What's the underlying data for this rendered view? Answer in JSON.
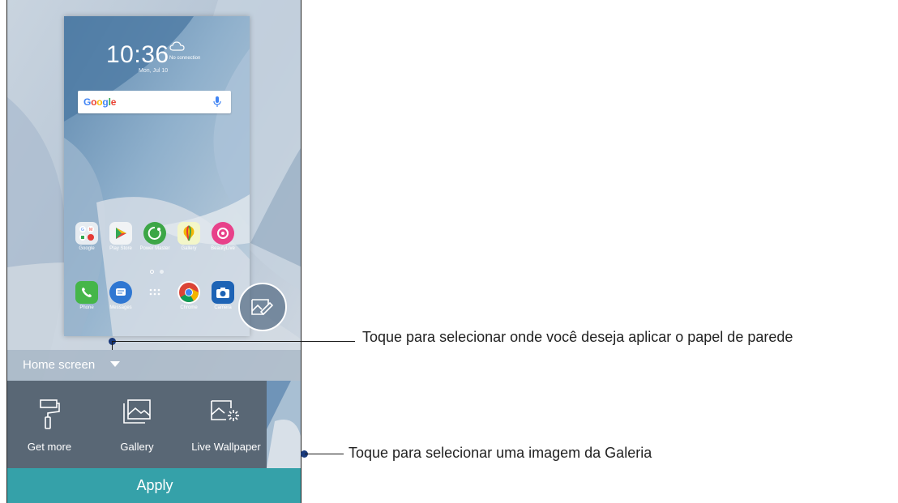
{
  "lockscreen": {
    "time": "10:36",
    "status": "No connection",
    "date": "Mon, Jul 10"
  },
  "search_widget": {
    "logo": "Google",
    "logo_letters": [
      "G",
      "o",
      "o",
      "g",
      "l",
      "e"
    ],
    "logo_colors": [
      "#4285f4",
      "#ea4335",
      "#fbbc05",
      "#4285f4",
      "#34a853",
      "#ea4335"
    ],
    "mic_icon": "mic-icon"
  },
  "home_apps": [
    {
      "label": "Google",
      "icon": "google-folder-icon"
    },
    {
      "label": "Play Store",
      "icon": "play-store-icon"
    },
    {
      "label": "Power Master",
      "icon": "power-master-icon"
    },
    {
      "label": "Gallery",
      "icon": "gallery-app-icon"
    },
    {
      "label": "BeautyLive",
      "icon": "beautylive-icon"
    }
  ],
  "dock_apps": [
    {
      "label": "Phone",
      "icon": "phone-icon"
    },
    {
      "label": "Messages",
      "icon": "messages-icon"
    },
    {
      "label": "",
      "icon": "app-drawer-icon"
    },
    {
      "label": "Chrome",
      "icon": "chrome-icon"
    },
    {
      "label": "Camera",
      "icon": "camera-icon"
    }
  ],
  "edit_button_icon": "edit-wallpaper-icon",
  "mode_selector": {
    "label": "Home screen"
  },
  "options": [
    {
      "label": "Get more",
      "icon": "paint-roller-icon"
    },
    {
      "label": "Gallery",
      "icon": "gallery-icon"
    },
    {
      "label": "Live Wallpaper",
      "icon": "live-wallpaper-icon"
    }
  ],
  "apply_label": "Apply",
  "callouts": {
    "mode": "Toque para selecionar onde você deseja aplicar o papel de parede",
    "gallery": "Toque para selecionar uma imagem da Galeria"
  },
  "colors": {
    "apply": "#35a1a9",
    "options_bg": "#596775",
    "callout_dot": "#1a3a7c"
  }
}
